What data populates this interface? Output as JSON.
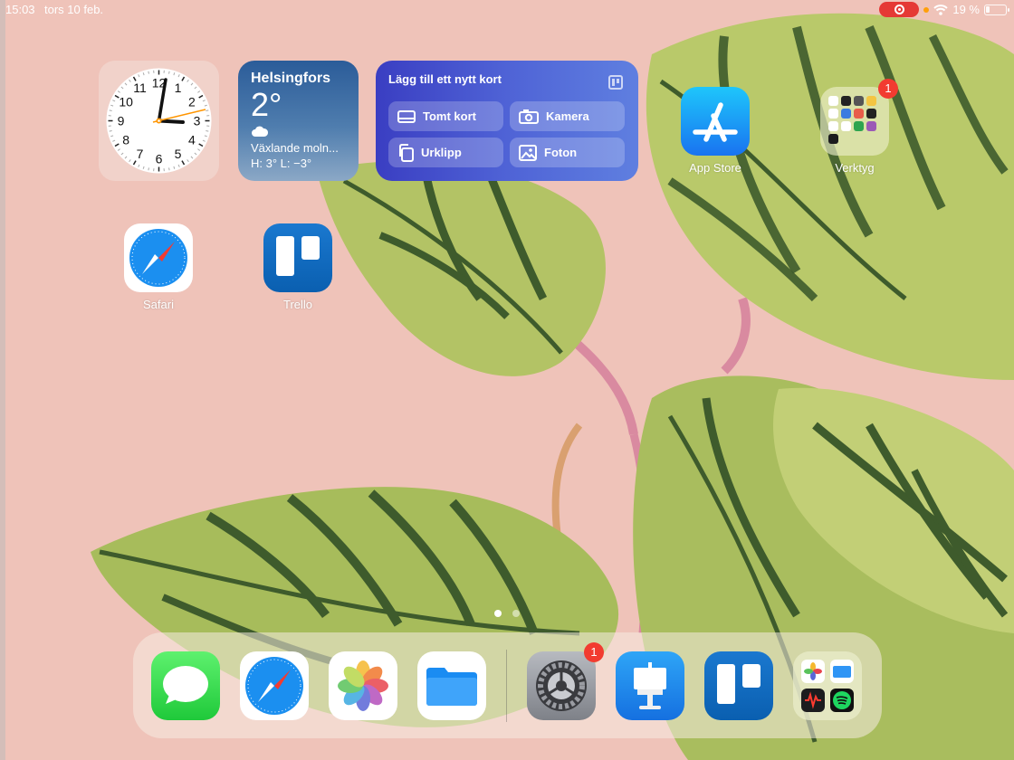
{
  "status_bar": {
    "time": "15:03",
    "date": "tors 10 feb.",
    "battery": "19 %"
  },
  "widgets": {
    "weather": {
      "city": "Helsingfors",
      "temp": "2°",
      "condition": "Växlande moln...",
      "high_low": "H: 3° L: −3°"
    },
    "trello": {
      "title": "Lägg till ett nytt kort",
      "buttons": [
        {
          "label": "Tomt kort",
          "icon": "card-icon"
        },
        {
          "label": "Kamera",
          "icon": "camera-icon"
        },
        {
          "label": "Urklipp",
          "icon": "clipboard-icon"
        },
        {
          "label": "Foton",
          "icon": "photo-icon"
        }
      ]
    },
    "clock": {
      "numerals": [
        "12",
        "1",
        "2",
        "3",
        "4",
        "5",
        "6",
        "7",
        "8",
        "9",
        "10",
        "11"
      ]
    }
  },
  "home_apps": [
    {
      "label": "App Store",
      "icon": "app-store-icon"
    },
    {
      "label": "Verktyg",
      "icon": "folder-icon",
      "badge": "1"
    },
    {
      "label": "Safari",
      "icon": "safari-icon"
    },
    {
      "label": "Trello",
      "icon": "trello-icon"
    }
  ],
  "dock": {
    "apps": [
      {
        "name": "messages",
        "icon": "messages-icon"
      },
      {
        "name": "safari",
        "icon": "safari-icon"
      },
      {
        "name": "photos",
        "icon": "photos-icon"
      },
      {
        "name": "files",
        "icon": "files-icon"
      },
      {
        "name": "settings",
        "icon": "settings-icon",
        "badge": "1"
      },
      {
        "name": "keynote",
        "icon": "keynote-icon"
      },
      {
        "name": "trello",
        "icon": "trello-icon"
      },
      {
        "name": "folder",
        "icon": "folder-icon"
      }
    ]
  },
  "colors": {
    "badge": "#f23b30",
    "wallpaper": "#efc3b9",
    "recording": "#e53935"
  }
}
